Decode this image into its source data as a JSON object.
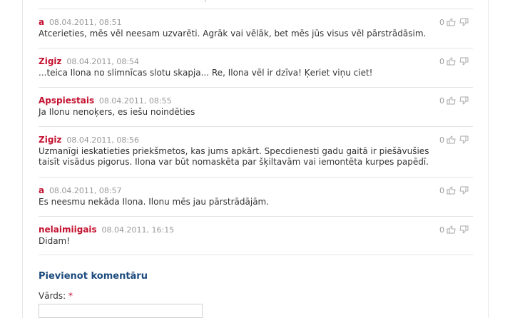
{
  "comments": [
    {
      "author": "a",
      "time": "08.04.2011, 08:51",
      "text": "Atcerieties, mēs vēl neesam uzvarēti. Agrāk vai vēlāk, bet mēs jūs visus vēl pārstrādāsim.",
      "votes": "0"
    },
    {
      "author": "Zigiz",
      "time": "08.04.2011, 08:54",
      "text": "...teica Ilona no slimnīcas slotu skapja... Re, Ilona vēl ir dzīva! Ķeriet viņu ciet!",
      "votes": "0"
    },
    {
      "author": "Apspiestais",
      "time": "08.04.2011, 08:55",
      "text": "Ja Ilonu nenoķers, es iešu noindēties",
      "votes": "0"
    },
    {
      "author": "Zigiz",
      "time": "08.04.2011, 08:56",
      "text": "Uzmanīgi ieskatieties priekšmetos, kas jums apkārt. Specdienesti gadu gaitā ir piešāvušies taisīt visādus pigorus. Ilona var būt nomaskēta par šķiltavām vai iemontēta kurpes papēdī.",
      "votes": "0"
    },
    {
      "author": "a",
      "time": "08.04.2011, 08:57",
      "text": "Es neesmu nekāda Ilona. Ilonu mēs jau pārstrādājām.",
      "votes": "0"
    },
    {
      "author": "nelaimiigais",
      "time": "08.04.2011, 16:15",
      "text": "Didam!",
      "votes": "0"
    }
  ],
  "form": {
    "title": "Pievienot komentāru",
    "name_label": "Vārds:",
    "required_mark": "*",
    "name_value": ""
  },
  "icons": {
    "like": "thumbs-up-icon",
    "dislike": "thumbs-down-icon"
  },
  "colors": {
    "author": "#c41230",
    "form_title": "#1b4a7d",
    "divider": "#e3e3e3",
    "muted": "#999999"
  }
}
